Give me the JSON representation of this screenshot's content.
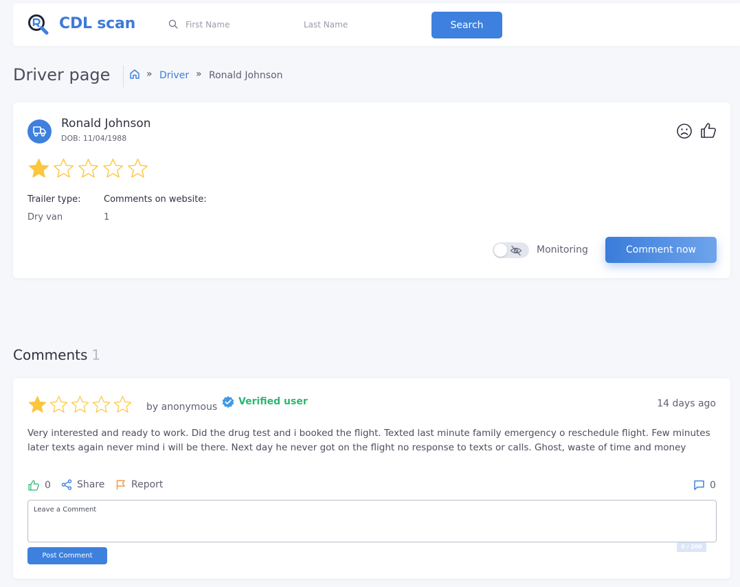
{
  "header": {
    "app_name": "CDL scan",
    "first_name_placeholder": "First Name",
    "last_name_placeholder": "Last Name",
    "search_label": "Search"
  },
  "page": {
    "title": "Driver page",
    "breadcrumb": {
      "separator": "»",
      "link_label": "Driver",
      "current": "Ronald Johnson"
    }
  },
  "driver": {
    "name": "Ronald Johnson",
    "dob_label": "DOB:",
    "dob": "11/04/1988",
    "rating": 1,
    "rating_max": 5,
    "trailer_type_label": "Trailer type:",
    "trailer_type": "Dry van",
    "comments_label": "Comments on website:",
    "comments_count": "1",
    "monitoring_label": "Monitoring",
    "monitoring_enabled": false,
    "comment_now_label": "Comment now"
  },
  "comments_section": {
    "heading": "Comments",
    "count": "1"
  },
  "comment": {
    "rating": 1,
    "rating_max": 5,
    "author": "by anonymous",
    "verified_label": "Verified user",
    "time": "14 days ago",
    "text": "Very interested and ready to work. Did the drug test and i booked the flight. Texted last minute family emergency o reschedule flight. Few minutes later texts again never mind i will be there. Next day he never got on the flight no response to texts or calls. Ghost, waste of time and money",
    "likes": "0",
    "share_label": "Share",
    "report_label": "Report",
    "replies": "0",
    "input_placeholder": "Leave a Comment",
    "char_counter": "0 / 200",
    "post_label": "Post Comment"
  },
  "colors": {
    "brand": "#3d7ad9",
    "star_filled": "#fcc63d",
    "verified": "#2bb673",
    "report": "#f2994a",
    "like": "#2bb673"
  }
}
